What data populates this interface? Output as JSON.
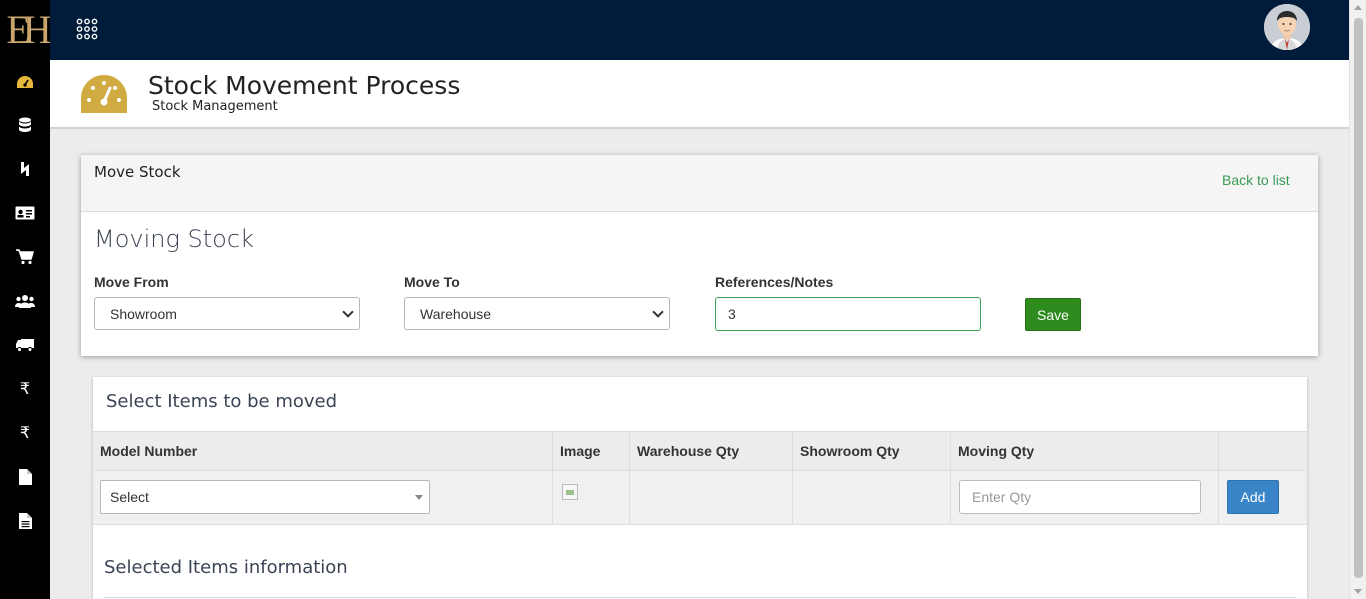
{
  "brand": {
    "logo_text": "EH"
  },
  "sidebar": {
    "items": [
      {
        "icon": "dashboard-icon"
      },
      {
        "icon": "database-icon"
      },
      {
        "icon": "exchange-icon"
      },
      {
        "icon": "id-card-icon"
      },
      {
        "icon": "cart-icon"
      },
      {
        "icon": "users-icon"
      },
      {
        "icon": "truck-icon"
      },
      {
        "icon": "rupee-icon",
        "glyph": "₹"
      },
      {
        "icon": "rupee-icon",
        "glyph": "₹"
      },
      {
        "icon": "file-icon"
      },
      {
        "icon": "file-text-icon"
      }
    ]
  },
  "header": {
    "title": "Stock Movement Process",
    "subtitle": "Stock Management"
  },
  "move_card": {
    "head_title": "Move Stock",
    "back_link": "Back to list",
    "subtitle": "Moving Stock",
    "move_from_label": "Move From",
    "move_from_value": "Showroom",
    "move_to_label": "Move To",
    "move_to_value": "Warehouse",
    "notes_label": "References/Notes",
    "notes_value": "3",
    "save_label": "Save"
  },
  "items_panel": {
    "title": "Select Items to be moved",
    "columns": [
      "Model Number",
      "Image",
      "Warehouse Qty",
      "Showroom Qty",
      "Moving Qty",
      ""
    ],
    "model_select_value": "Select",
    "qty_placeholder": "Enter Qty",
    "add_label": "Add",
    "selected_title": "Selected Items information"
  },
  "colors": {
    "topbar": "#011b3a",
    "sidebar": "#000000",
    "accent_gold": "#e5b73b",
    "link_green": "#3c9a57",
    "save_green": "#2e8b1d",
    "add_blue": "#3a85c7"
  }
}
